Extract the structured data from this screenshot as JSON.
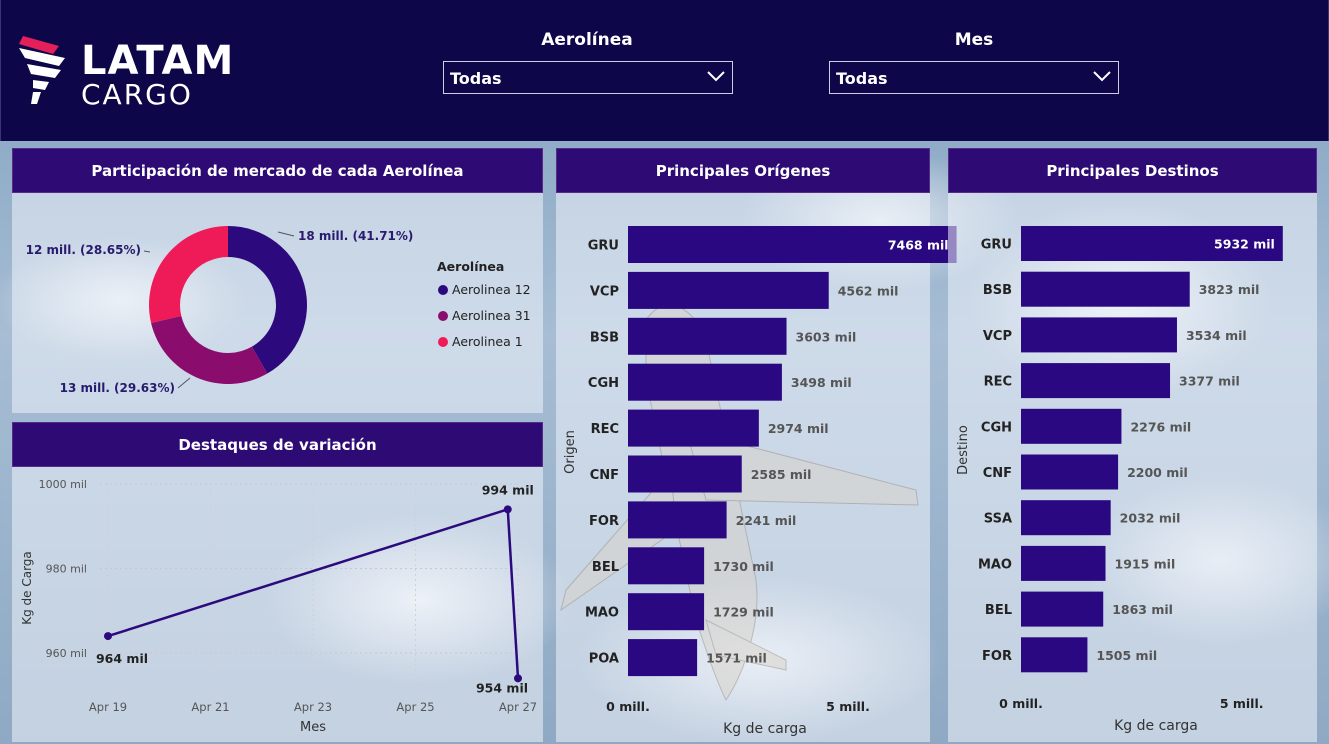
{
  "brand": {
    "word1": "LATAM",
    "word2": "CARGO"
  },
  "filters": {
    "airline": {
      "title": "Aerolínea",
      "value": "Todas"
    },
    "month": {
      "title": "Mes",
      "value": "Todas"
    }
  },
  "colors": {
    "header": "#0d0648",
    "panel_title": "#2e0a74",
    "bar": "#2a0882",
    "series1": "#2c0a7e",
    "series2": "#8a0d6e",
    "series3": "#ee1b58"
  },
  "market_share": {
    "title": "Participación de mercado de cada Aerolínea",
    "legend_title": "Aerolínea",
    "labels": [
      "18 mill. (41.71%)",
      "13 mill. (29.63%)",
      "12 mill. (28.65%)"
    ]
  },
  "origins": {
    "title": "Principales Orígenes",
    "y_axis_title": "Origen",
    "x_axis_title": "Kg de carga",
    "x_ticks": [
      "0 mill.",
      "5 mill."
    ]
  },
  "destinations": {
    "title": "Principales Destinos",
    "y_axis_title": "Destino",
    "x_axis_title": "Kg de carga",
    "x_ticks": [
      "0 mill.",
      "5 mill."
    ]
  },
  "variation": {
    "title": "Destaques de variación",
    "x_axis_title": "Mes",
    "y_axis_title": "Kg de Carga"
  },
  "chart_data": [
    {
      "type": "pie",
      "title": "Participación de mercado de cada Aerolínea",
      "legend_title": "Aerolínea",
      "categories": [
        "Aerolinea 12",
        "Aerolinea 31",
        "Aerolinea 1"
      ],
      "values": [
        41.71,
        29.63,
        28.65
      ],
      "data_labels": [
        "18 mill. (41.71%)",
        "13 mill. (29.63%)",
        "12 mill. (28.65%)"
      ],
      "colors": [
        "#2c0a7e",
        "#8a0d6e",
        "#ee1b58"
      ],
      "legend": "right"
    },
    {
      "type": "bar",
      "title": "Principales Orígenes",
      "ylabel": "Origen",
      "xlabel": "Kg de carga",
      "categories": [
        "GRU",
        "VCP",
        "BSB",
        "CGH",
        "REC",
        "CNF",
        "FOR",
        "BEL",
        "MAO",
        "POA"
      ],
      "values": [
        7468,
        4562,
        3603,
        3498,
        2974,
        2585,
        2241,
        1730,
        1729,
        1571
      ],
      "value_unit": "mil",
      "xlim": [
        0,
        10000
      ],
      "x_ticks": [
        "0 mill.",
        "5 mill."
      ],
      "orientation": "horizontal"
    },
    {
      "type": "bar",
      "title": "Principales Destinos",
      "ylabel": "Destino",
      "xlabel": "Kg de carga",
      "categories": [
        "GRU",
        "BSB",
        "VCP",
        "REC",
        "CGH",
        "CNF",
        "SSA",
        "MAO",
        "BEL",
        "FOR"
      ],
      "values": [
        5932,
        3823,
        3534,
        3377,
        2276,
        2200,
        2032,
        1915,
        1863,
        1505
      ],
      "value_unit": "mil",
      "xlim": [
        0,
        7500
      ],
      "x_ticks": [
        "0 mill.",
        "5 mill."
      ],
      "orientation": "horizontal"
    },
    {
      "type": "line",
      "title": "Destaques de variación",
      "xlabel": "Mes",
      "ylabel": "Kg de Carga",
      "x_ticks": [
        "Apr 19",
        "Apr 21",
        "Apr 23",
        "Apr 25",
        "Apr 27"
      ],
      "y_ticks": [
        "1000 mil",
        "980 mil",
        "960 mil"
      ],
      "ylim": [
        955,
        1002
      ],
      "points": [
        {
          "x": "Apr 19",
          "y": 964,
          "label": "964 mil"
        },
        {
          "x": "Apr 26.8",
          "y": 994,
          "label": "994 mil"
        },
        {
          "x": "Apr 27",
          "y": 954,
          "label": "954 mil"
        }
      ],
      "grid": true
    }
  ]
}
